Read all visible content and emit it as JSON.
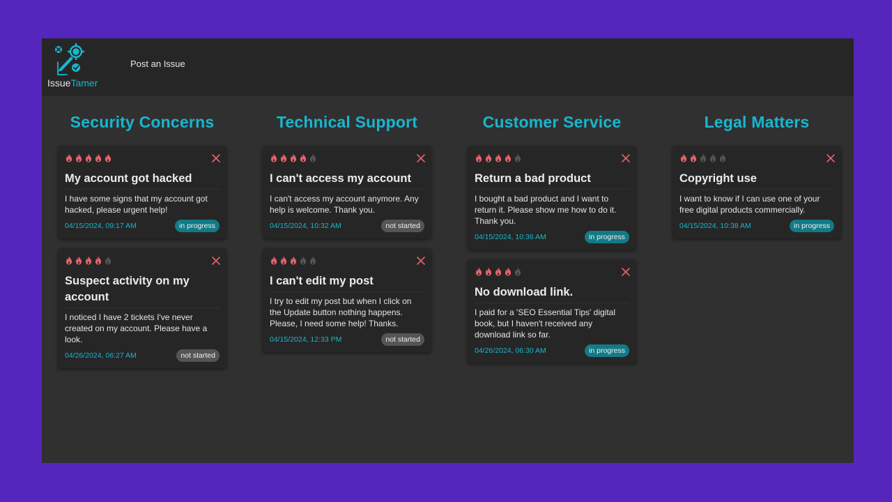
{
  "app": {
    "logo_text_a": "Issue",
    "logo_text_b": "Tamer",
    "nav_post": "Post an Issue",
    "accent_color": "#19b6cf",
    "flame_on_color": "#e8616a",
    "flame_off_color": "#555555"
  },
  "columns": [
    {
      "title": "Security Concerns",
      "cards": [
        {
          "priority": 5,
          "title": "My account got hacked",
          "body": "I have some signs that my account got hacked, please urgent help!",
          "date": "04/15/2024, 09:17 AM",
          "status": "in progress"
        },
        {
          "priority": 4,
          "title": "Suspect activity on my account",
          "body": "I noticed I have 2 tickets I've never created on my account. Please have a look.",
          "date": "04/26/2024, 06:27 AM",
          "status": "not started"
        }
      ]
    },
    {
      "title": "Technical Support",
      "cards": [
        {
          "priority": 4,
          "title": "I can't access my account",
          "body": "I can't access my account anymore. Any help is welcome. Thank you.",
          "date": "04/15/2024, 10:32 AM",
          "status": "not started"
        },
        {
          "priority": 3,
          "title": "I can't edit my post",
          "body": "I try to edit my post but when I click on the Update button nothing happens. Please, I need some help! Thanks.",
          "date": "04/15/2024, 12:33 PM",
          "status": "not started"
        }
      ]
    },
    {
      "title": "Customer Service",
      "cards": [
        {
          "priority": 4,
          "title": "Return a bad product",
          "body": "I bought a bad product and I want to return it. Please show me how to do it. Thank you.",
          "date": "04/15/2024, 10:36 AM",
          "status": "in progress"
        },
        {
          "priority": 4,
          "title": "No download link.",
          "body": "I paid for a 'SEO Essential Tips' digital book, but I haven't received any download link so far.",
          "date": "04/26/2024, 06:30 AM",
          "status": "in progress"
        }
      ]
    },
    {
      "title": "Legal Matters",
      "cards": [
        {
          "priority": 2,
          "title": "Copyright use",
          "body": "I want to know if I can use one of your free digital products commercially.",
          "date": "04/15/2024, 10:38 AM",
          "status": "in progress"
        }
      ]
    }
  ]
}
